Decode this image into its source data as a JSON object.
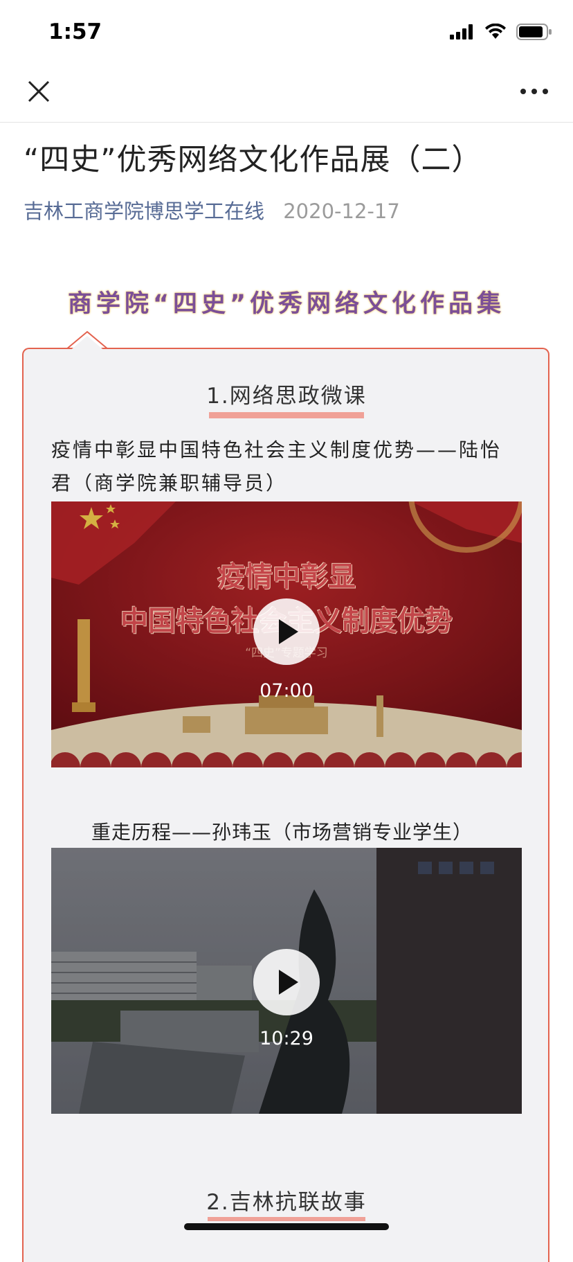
{
  "status_bar": {
    "time": "1:57"
  },
  "article": {
    "title": "“四史”优秀网络文化作品展（二）",
    "account": "吉林工商学院博思学工在线",
    "date": "2020-12-17"
  },
  "collection": {
    "title": "商学院“四史”优秀网络文化作品集"
  },
  "sections": [
    {
      "heading": "1.网络思政微课",
      "videos": [
        {
          "title_line1": "疫情中彰显中国特色社会主义制度优势——陆怡",
          "title_line2": "君（商学院兼职辅导员）",
          "thumb_line1": "疫情中彰显",
          "thumb_line2": "中国特色社会主义制度优势",
          "thumb_sub": "“四史”专题学习",
          "duration": "07:00"
        },
        {
          "title": "重走历程——孙玮玉（市场营销专业学生）",
          "duration": "10:29"
        }
      ]
    },
    {
      "heading": "2.吉林抗联故事"
    }
  ],
  "colors": {
    "accent_border": "#e3624e",
    "link": "#576b95",
    "collection_text": "#7b4f97"
  }
}
